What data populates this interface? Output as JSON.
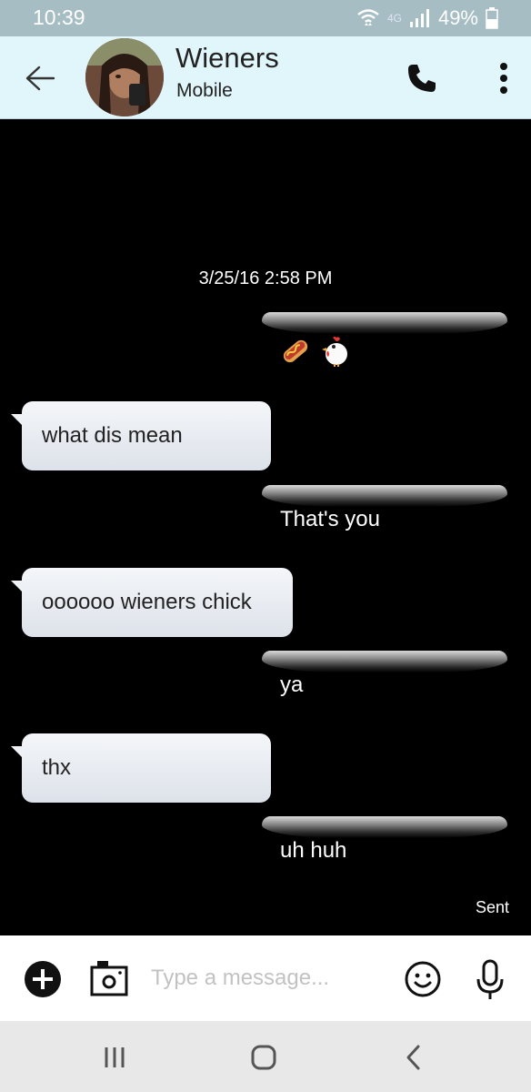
{
  "status_bar": {
    "time": "10:39",
    "network": "4G",
    "battery": "49%"
  },
  "header": {
    "contact_name": "Wieners",
    "contact_type": "Mobile"
  },
  "conversation": {
    "timestamp": "3/25/16 2:58 PM",
    "messages": [
      {
        "direction": "outgoing",
        "text": "",
        "emoji": [
          "hot-dog",
          "chicken"
        ]
      },
      {
        "direction": "incoming",
        "text": "what dis mean"
      },
      {
        "direction": "outgoing",
        "text": "That's you"
      },
      {
        "direction": "incoming",
        "text": "oooooo wieners chick"
      },
      {
        "direction": "outgoing",
        "text": "ya"
      },
      {
        "direction": "incoming",
        "text": "thx"
      },
      {
        "direction": "outgoing",
        "text": "uh huh"
      }
    ],
    "status": "Sent"
  },
  "composer": {
    "placeholder": "Type a message...",
    "value": ""
  },
  "colors": {
    "status_bar": "#a6bdc4",
    "header": "#e1f6fb",
    "incoming_bubble": "#e6eaf0",
    "background": "#000000",
    "nav_bar": "#e8e8e8"
  }
}
